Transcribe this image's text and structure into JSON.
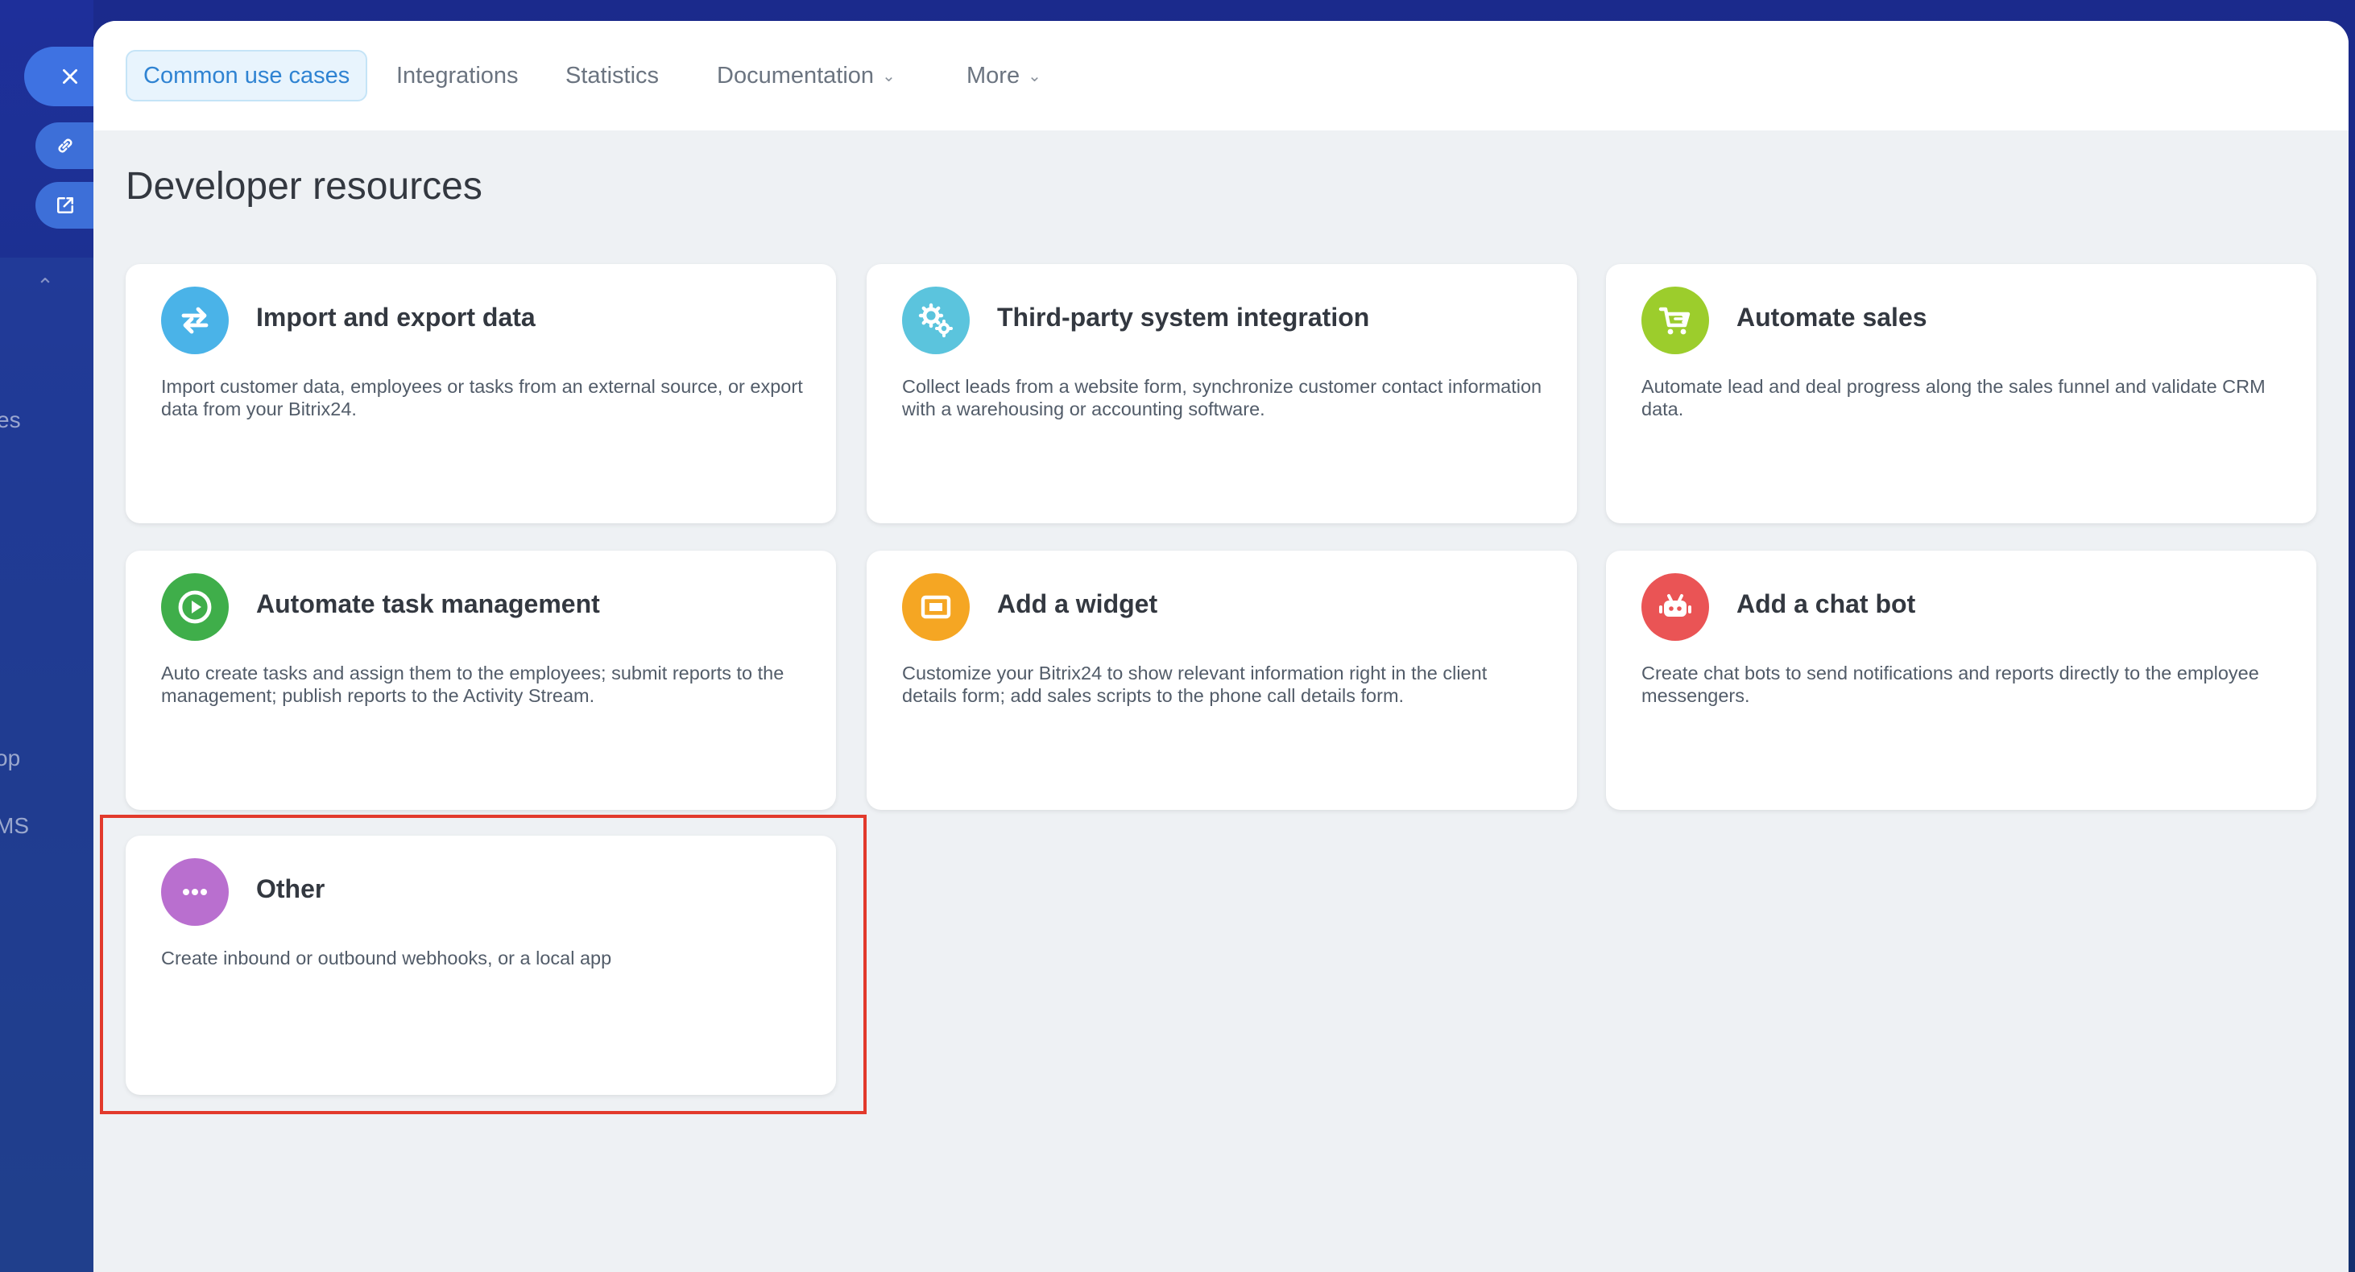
{
  "background": {
    "fragment_1": "es",
    "fragment_2": "op",
    "fragment_3": "MS"
  },
  "side_buttons": {
    "close_icon": "close-icon",
    "link_icon": "link-icon",
    "external_icon": "external-link-icon"
  },
  "tabs": [
    {
      "label": "Common use cases",
      "active": true
    },
    {
      "label": "Integrations"
    },
    {
      "label": "Statistics"
    },
    {
      "label": "Documentation",
      "has_dropdown": true
    },
    {
      "label": "More",
      "has_dropdown": true
    }
  ],
  "page_title": "Developer resources",
  "cards": [
    {
      "title": "Import and export data",
      "description": "Import customer data, employees or tasks from an external source, or export data from your Bitrix24.",
      "icon": "arrows-exchange-icon",
      "color": "#4ab3e8"
    },
    {
      "title": "Third-party system integration",
      "description": "Collect leads from a website form, synchronize customer contact information with a warehousing or accounting software.",
      "icon": "gears-icon",
      "color": "#5bc4dd"
    },
    {
      "title": "Automate sales",
      "description": "Automate lead and deal progress along the sales funnel and validate CRM data.",
      "icon": "cart-icon",
      "color": "#9ccd2c"
    },
    {
      "title": "Automate task management",
      "description": "Auto create tasks and assign them to the employees; submit reports to the management; publish reports to the Activity Stream.",
      "icon": "play-icon",
      "color": "#3fae4a"
    },
    {
      "title": "Add a widget",
      "description": "Customize your Bitrix24 to show relevant information right in the client details form; add sales scripts to the phone call details form.",
      "icon": "widget-icon",
      "color": "#f5a623"
    },
    {
      "title": "Add a chat bot",
      "description": "Create chat bots to send notifications and reports directly to the employee messengers.",
      "icon": "robot-icon",
      "color": "#ea5455"
    },
    {
      "title": "Other",
      "description": "Create inbound or outbound webhooks, or a local app",
      "icon": "more-dots-icon",
      "color": "#b96fcf"
    }
  ],
  "highlight_color": "#e23a2c"
}
